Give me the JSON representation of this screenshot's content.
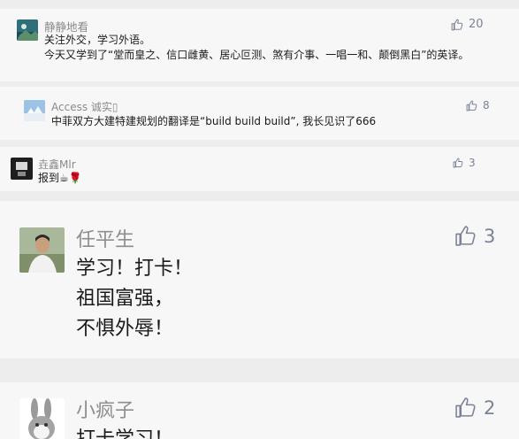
{
  "colors": {
    "background": "#ededed",
    "card": "#f7f7f7",
    "name_text": "#8a8a8a",
    "body_text": "#1a1a1a",
    "like_icon": "#7a8396"
  },
  "comments": [
    {
      "name": "静静地看",
      "likes": "20",
      "lines": [
        "关注外交，学习外语。",
        "今天又学到了“堂而皇之、信口雌黄、居心叵测、煞有介事、一唱一和、颠倒黑白”的英译。"
      ]
    },
    {
      "name": "Access 诚实▯",
      "likes": "8",
      "lines": [
        "中菲双方大建特建规划的翻译是“build build build”, 我长见识了666"
      ]
    },
    {
      "name": "垚鑫Mlr",
      "likes": "3",
      "lines": [
        "报到☕🌹"
      ]
    },
    {
      "name": "任平生",
      "likes": "3",
      "lines": [
        "学习！打卡！",
        "祖国富强，",
        "不惧外辱！"
      ]
    },
    {
      "name": "小疯子",
      "likes": "2",
      "lines": [
        "打卡学习！"
      ]
    }
  ]
}
